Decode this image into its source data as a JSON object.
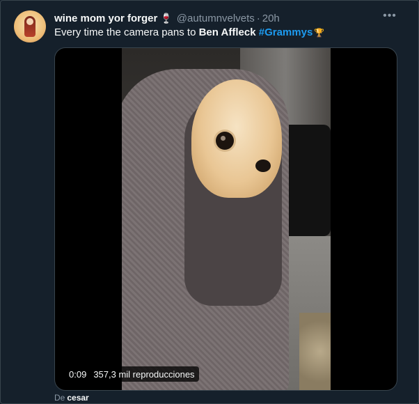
{
  "tweet": {
    "display_name": "wine mom yor forger",
    "name_emoji": "🍷",
    "handle": "@autumnvelvets",
    "separator": "·",
    "time": "20h",
    "more_label": "•••",
    "text_prefix": "Every time the camera pans to ",
    "text_mention": "Ben Affleck",
    "text_hashtag": "#Grammys",
    "hashtag_emoji": "🏆",
    "hashtag_color": "#1d9bf0"
  },
  "video": {
    "time": "0:09",
    "views": "357,3 mil reproducciones"
  },
  "source": {
    "prefix": "De",
    "name": "cesar"
  }
}
